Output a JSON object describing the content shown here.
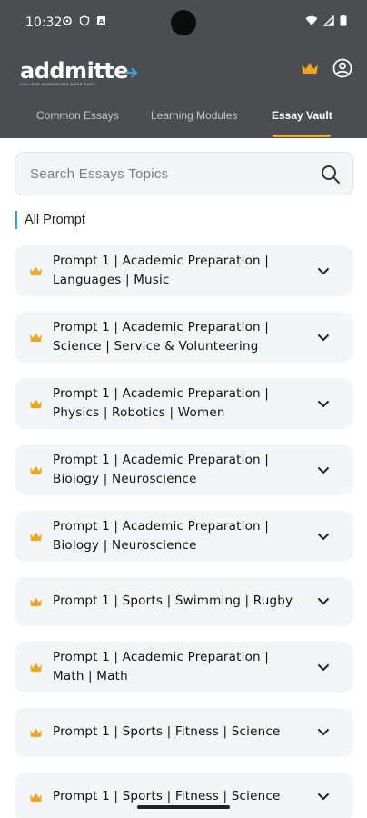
{
  "status_bar": {
    "time": "10:32"
  },
  "app": {
    "logo_text": "addmitte",
    "logo_tagline": "COLLEGE ADMISSIONS MADE EASY"
  },
  "tabs": [
    {
      "label": "Common Essays",
      "active": false
    },
    {
      "label": "Learning Modules",
      "active": false
    },
    {
      "label": "Essay Vault",
      "active": true
    }
  ],
  "search": {
    "placeholder": "Search Essays Topics"
  },
  "section": {
    "title": "All Prompt"
  },
  "prompts": [
    {
      "line1": "Prompt 1 | Academic Preparation |",
      "line2": "Languages | Music"
    },
    {
      "line1": "Prompt 1 | Academic Preparation |",
      "line2": "Science | Service & Volunteering"
    },
    {
      "line1": "Prompt 1 | Academic Preparation |",
      "line2": "Physics | Robotics | Women"
    },
    {
      "line1": "Prompt 1 | Academic Preparation |",
      "line2": "Biology | Neuroscience"
    },
    {
      "line1": "Prompt 1 | Academic Preparation |",
      "line2": "Biology | Neuroscience"
    },
    {
      "line1": "Prompt 1 | Sports | Swimming | Rugby",
      "line2": ""
    },
    {
      "line1": "Prompt 1 | Academic Preparation |",
      "line2": "Math | Math"
    },
    {
      "line1": "Prompt 1 | Sports | Fitness | Science",
      "line2": ""
    },
    {
      "line1": "Prompt 1 | Sports | Fitness | Science",
      "line2": ""
    }
  ],
  "colors": {
    "header_bg": "#4b4d51",
    "accent_gold": "#f0a51f",
    "section_bar": "#3aa0d8",
    "card_bg": "#f3f5f7",
    "logo_arrow": "#3aa0d8"
  },
  "icons": {
    "crown": "crown-icon",
    "account": "account-circle-icon",
    "search": "search-icon",
    "chevron": "chevron-down-icon"
  }
}
